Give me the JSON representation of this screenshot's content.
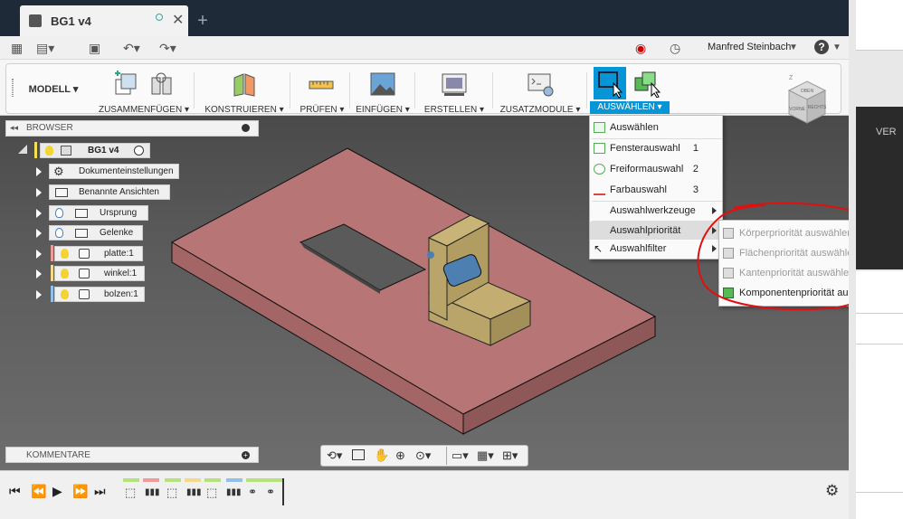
{
  "document": {
    "title": "BG1 v4"
  },
  "toolbar": {
    "user_name": "Manfred Steinbach",
    "help_label": "?"
  },
  "ribbon": {
    "workspace": "MODELL",
    "groups": [
      {
        "label": "ZUSAMMENFÜGEN"
      },
      {
        "label": "KONSTRUIEREN"
      },
      {
        "label": "PRÜFEN"
      },
      {
        "label": "EINFÜGEN"
      },
      {
        "label": "ERSTELLEN"
      },
      {
        "label": "ZUSATZMODULE"
      },
      {
        "label": "AUSWÄHLEN"
      }
    ]
  },
  "browser": {
    "header": "BROWSER",
    "items": [
      {
        "label": "BG1 v4"
      },
      {
        "label": "Dokumenteinstellungen"
      },
      {
        "label": "Benannte Ansichten"
      },
      {
        "label": "Ursprung"
      },
      {
        "label": "Gelenke"
      },
      {
        "label": "platte:1"
      },
      {
        "label": "winkel:1"
      },
      {
        "label": "bolzen:1"
      }
    ],
    "comments_label": "KOMMENTARE"
  },
  "select_menu": {
    "items": [
      {
        "label": "Auswählen",
        "shortcut": ""
      },
      {
        "label": "Fensterauswahl",
        "shortcut": "1"
      },
      {
        "label": "Freiformauswahl",
        "shortcut": "2"
      },
      {
        "label": "Farbauswahl",
        "shortcut": "3"
      },
      {
        "label": "Auswahlwerkzeuge",
        "shortcut": ""
      },
      {
        "label": "Auswahlpriorität",
        "shortcut": ""
      },
      {
        "label": "Auswahlfilter",
        "shortcut": ""
      }
    ]
  },
  "priority_submenu": {
    "items": [
      {
        "label": "Körperpriorität auswählen",
        "enabled": false
      },
      {
        "label": "Flächenpriorität auswählen",
        "enabled": false
      },
      {
        "label": "Kantenpriorität auswählen",
        "enabled": false
      },
      {
        "label": "Komponentenpriorität auswählen",
        "enabled": true
      }
    ]
  },
  "viewcube": {
    "front": "VORNE",
    "right": "RECHTS",
    "top": "OBEN"
  },
  "right_pane": {
    "text": "VER"
  },
  "colors": {
    "accent": "#0696d7",
    "plate": "#b87575",
    "bracket": "#b9a56a",
    "pin": "#4d7fb0",
    "annotation": "#e01010"
  }
}
